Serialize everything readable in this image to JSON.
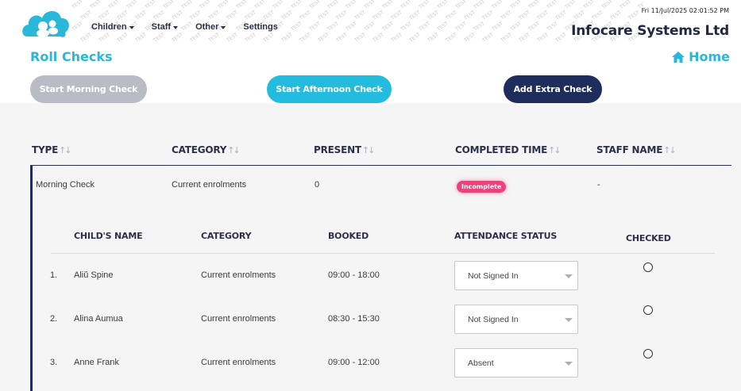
{
  "header": {
    "nav": [
      {
        "label": "Children",
        "has_dropdown": true
      },
      {
        "label": "Staff",
        "has_dropdown": true
      },
      {
        "label": "Other",
        "has_dropdown": true
      },
      {
        "label": "Settings",
        "has_dropdown": false
      }
    ],
    "datetime": "Fri 11/Jul/2025 02:01:52 PM",
    "company": "Infocare Systems Ltd",
    "watermark_text": "TEST"
  },
  "page": {
    "title": "Roll Checks",
    "home_label": "Home"
  },
  "actions": {
    "morning": "Start Morning Check",
    "afternoon": "Start Afternoon Check",
    "extra": "Add Extra Check"
  },
  "table": {
    "headers": {
      "type": "TYPE",
      "category": "CATEGORY",
      "present": "PRESENT",
      "completed_time": "COMPLETED TIME",
      "staff_name": "STAFF NAME"
    },
    "row": {
      "type": "Morning Check",
      "category": "Current enrolments",
      "present": "0",
      "completed_status": "Incomplete",
      "staff_name": "-"
    }
  },
  "children": {
    "headers": {
      "name": "CHILD'S NAME",
      "category": "CATEGORY",
      "booked": "BOOKED",
      "attendance": "ATTENDANCE STATUS",
      "checked": "CHECKED"
    },
    "rows": [
      {
        "num": "1.",
        "name": "Aliŭ Spine",
        "category": "Current enrolments",
        "booked": "09:00 - 18:00",
        "status": "Not Signed In"
      },
      {
        "num": "2.",
        "name": "Alina Aumua",
        "category": "Current enrolments",
        "booked": "08:30 - 15:30",
        "status": "Not Signed In"
      },
      {
        "num": "3.",
        "name": "Anne Frank",
        "category": "Current enrolments",
        "booked": "09:00 - 12:00",
        "status": "Absent"
      }
    ]
  },
  "colors": {
    "accent": "#29b7da",
    "navy": "#1f2d5c",
    "badge": "#e8437b",
    "disabled": "#b9bcc4"
  }
}
